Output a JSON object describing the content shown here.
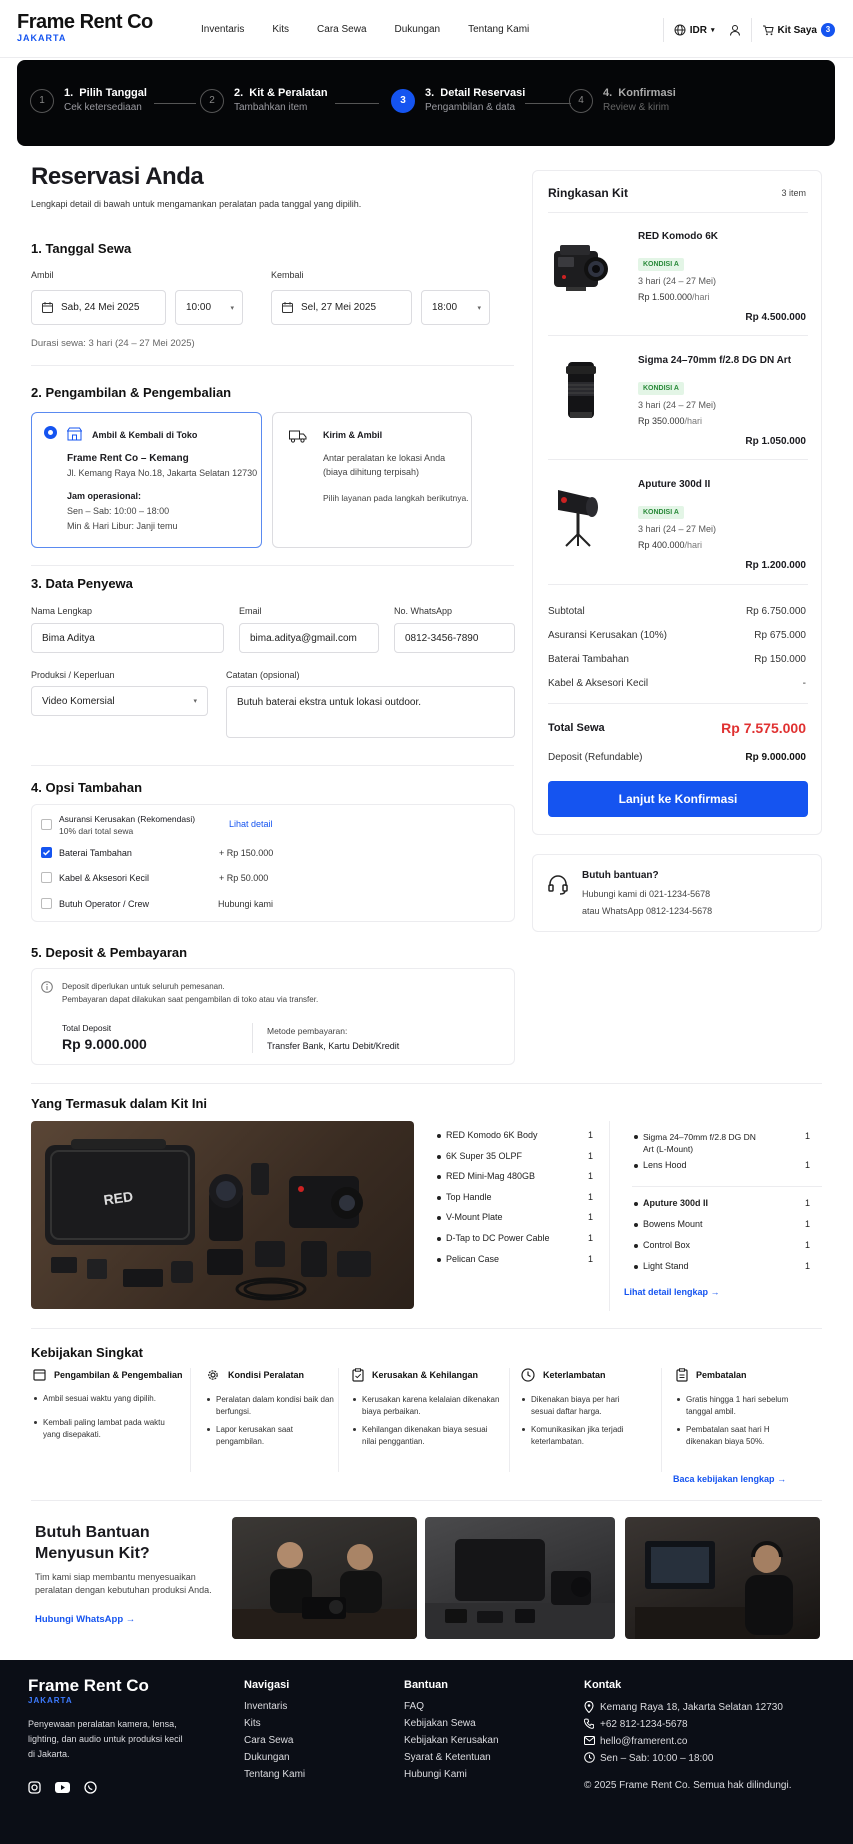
{
  "header": {
    "brand": "Frame Rent Co",
    "city": "JAKARTA",
    "nav": [
      "Inventaris",
      "Kits",
      "Cara Sewa",
      "Dukungan",
      "Tentang Kami"
    ],
    "currency": "IDR",
    "cart_label": "Kit Saya",
    "cart_count": "3"
  },
  "steps": [
    {
      "num": "1",
      "title": "Pilih Tanggal",
      "sub": "Cek ketersediaan"
    },
    {
      "num": "2",
      "title": "Kit & Peralatan",
      "sub": "Tambahkan item"
    },
    {
      "num": "3",
      "title": "Detail Reservasi",
      "sub": "Pengambilan & data"
    },
    {
      "num": "4",
      "title": "Konfirmasi",
      "sub": "Review & kirim"
    }
  ],
  "page": {
    "title": "Reservasi Anda",
    "subtitle": "Lengkapi detail di bawah untuk mengamankan peralatan pada tanggal yang dipilih."
  },
  "dates": {
    "heading": "1. Tanggal Sewa",
    "pickup_label": "Ambil",
    "pickup_date": "Sab, 24 Mei 2025",
    "pickup_time": "10:00",
    "return_label": "Kembali",
    "return_date": "Sel, 27 Mei 2025",
    "return_time": "18:00",
    "duration": "Durasi sewa: 3 hari (24 – 27 Mei 2025)"
  },
  "pickup": {
    "heading": "2. Pengambilan & Pengembalian",
    "store": {
      "title": "Ambil & Kembali di Toko",
      "name": "Frame Rent Co – Kemang",
      "address": "Jl. Kemang Raya No.18, Jakarta Selatan 12730",
      "hours_label": "Jam operasional:",
      "hours1": "Sen – Sab: 10:00 – 18:00",
      "hours2": "Min & Hari Libur: Janji temu"
    },
    "delivery": {
      "title": "Kirim & Ambil",
      "desc1": "Antar peralatan ke lokasi Anda",
      "desc2": "(biaya dihitung terpisah)",
      "note": "Pilih layanan pada langkah berikutnya."
    }
  },
  "renter": {
    "heading": "3. Data Penyewa",
    "name_label": "Nama Lengkap",
    "name": "Bima Aditya",
    "email_label": "Email",
    "email": "bima.aditya@gmail.com",
    "wa_label": "No. WhatsApp",
    "wa": "0812-3456-7890",
    "purpose_label": "Produksi / Keperluan",
    "purpose": "Video Komersial",
    "notes_label": "Catatan (opsional)",
    "notes": "Butuh baterai ekstra untuk lokasi outdoor."
  },
  "options": {
    "heading": "4. Opsi Tambahan",
    "items": [
      {
        "label": "Asuransi Kerusakan (Rekomendasi)",
        "sub": "10% dari total sewa",
        "value": "Lihat detail",
        "checked": false
      },
      {
        "label": "Baterai Tambahan",
        "sub": "",
        "value": "+ Rp 150.000",
        "checked": true
      },
      {
        "label": "Kabel & Aksesori Kecil",
        "sub": "",
        "value": "+ Rp 50.000",
        "checked": false
      },
      {
        "label": "Butuh Operator / Crew",
        "sub": "",
        "value": "Hubungi kami",
        "checked": false
      }
    ]
  },
  "deposit": {
    "heading": "5. Deposit & Pembayaran",
    "info1": "Deposit diperlukan untuk seluruh pemesanan.",
    "info2": "Pembayaran dapat dilakukan saat pengambilan di toko atau via transfer.",
    "total_label": "Total Deposit",
    "total": "Rp 9.000.000",
    "method_label": "Metode pembayaran:",
    "method": "Transfer Bank, Kartu Debit/Kredit"
  },
  "summary": {
    "title": "Ringkasan Kit",
    "count": "3 item",
    "items": [
      {
        "name": "RED Komodo 6K",
        "cond": "KONDISI A",
        "days": "3 hari (24 – 27 Mei)",
        "rate": "Rp 1.500.000",
        "unit": "/hari",
        "total": "Rp 4.500.000"
      },
      {
        "name": "Sigma 24–70mm f/2.8 DG DN Art",
        "cond": "KONDISI A",
        "days": "3 hari (24 – 27 Mei)",
        "rate": "Rp 350.000",
        "unit": "/hari",
        "total": "Rp 1.050.000"
      },
      {
        "name": "Aputure 300d II",
        "cond": "KONDISI A",
        "days": "3 hari (24 – 27 Mei)",
        "rate": "Rp 400.000",
        "unit": "/hari",
        "total": "Rp 1.200.000"
      }
    ],
    "lines": [
      {
        "label": "Subtotal",
        "value": "Rp 6.750.000"
      },
      {
        "label": "Asuransi Kerusakan (10%)",
        "value": "Rp 675.000"
      },
      {
        "label": "Baterai Tambahan",
        "value": "Rp 150.000"
      },
      {
        "label": "Kabel & Aksesori Kecil",
        "value": "-"
      }
    ],
    "total_label": "Total Sewa",
    "total": "Rp 7.575.000",
    "deposit_label": "Deposit (Refundable)",
    "deposit": "Rp 9.000.000",
    "cta": "Lanjut ke Konfirmasi"
  },
  "help": {
    "title": "Butuh bantuan?",
    "line1": "Hubungi kami di 021-1234-5678",
    "line2": "atau WhatsApp 0812-1234-5678"
  },
  "kit": {
    "heading": "Yang Termasuk dalam Kit Ini",
    "col1": [
      {
        "n": "RED Komodo 6K Body",
        "q": "1"
      },
      {
        "n": "6K Super 35 OLPF",
        "q": "1"
      },
      {
        "n": "RED Mini-Mag 480GB",
        "q": "1"
      },
      {
        "n": "Top Handle",
        "q": "1"
      },
      {
        "n": "V-Mount Plate",
        "q": "1"
      },
      {
        "n": "D-Tap to DC Power Cable",
        "q": "1"
      },
      {
        "n": "Pelican Case",
        "q": "1"
      }
    ],
    "col2": [
      {
        "n": "Sigma 24–70mm f/2.8 DG DN Art (L-Mount)",
        "q": "1"
      },
      {
        "n": "Lens Hood",
        "q": "1"
      }
    ],
    "col3": [
      {
        "n": "Aputure 300d II",
        "q": "1"
      },
      {
        "n": "Bowens Mount",
        "q": "1"
      },
      {
        "n": "Control Box",
        "q": "1"
      },
      {
        "n": "Light Stand",
        "q": "1"
      }
    ],
    "more": "Lihat detail lengkap"
  },
  "policy": {
    "heading": "Kebijakan Singkat",
    "items": [
      {
        "title": "Pengambilan & Pengembalian",
        "b": [
          "Ambil sesuai waktu yang dipilih.",
          "Kembali paling lambat pada waktu yang disepakati."
        ]
      },
      {
        "title": "Kondisi Peralatan",
        "b": [
          "Peralatan dalam kondisi baik dan berfungsi.",
          "Lapor kerusakan saat pengambilan."
        ]
      },
      {
        "title": "Kerusakan & Kehilangan",
        "b": [
          "Kerusakan karena kelalaian dikenakan biaya perbaikan.",
          "Kehilangan dikenakan biaya sesuai nilai penggantian."
        ]
      },
      {
        "title": "Keterlambatan",
        "b": [
          "Dikenakan biaya per hari sesuai daftar harga.",
          "Komunikasikan jika terjadi keterlambatan."
        ]
      },
      {
        "title": "Pembatalan",
        "b": [
          "Gratis hingga 1 hari sebelum tanggal ambil.",
          "Pembatalan saat hari H dikenakan biaya 50%."
        ]
      }
    ],
    "more": "Baca kebijakan lengkap"
  },
  "promo": {
    "title1": "Butuh Bantuan",
    "title2": "Menyusun Kit?",
    "desc1": "Tim kami siap membantu menyesuaikan",
    "desc2": "peralatan dengan kebutuhan produksi Anda.",
    "link": "Hubungi WhatsApp"
  },
  "footer": {
    "brand": "Frame Rent Co",
    "city": "JAKARTA",
    "desc1": "Penyewaan peralatan kamera, lensa,",
    "desc2": "lighting, dan audio untuk produksi kecil",
    "desc3": "di Jakarta.",
    "nav_title": "Navigasi",
    "nav": [
      "Inventaris",
      "Kits",
      "Cara Sewa",
      "Dukungan",
      "Tentang Kami"
    ],
    "help_title": "Bantuan",
    "help": [
      "FAQ",
      "Kebijakan Sewa",
      "Kebijakan Kerusakan",
      "Syarat & Ketentuan",
      "Hubungi Kami"
    ],
    "contact_title": "Kontak",
    "address": "Kemang Raya 18, Jakarta Selatan 12730",
    "phone": "+62 812-1234-5678",
    "email": "hello@framerent.co",
    "hours": "Sen – Sab: 10:00 – 18:00",
    "copyright": "© 2025 Frame Rent Co. Semua hak dilindungi."
  }
}
